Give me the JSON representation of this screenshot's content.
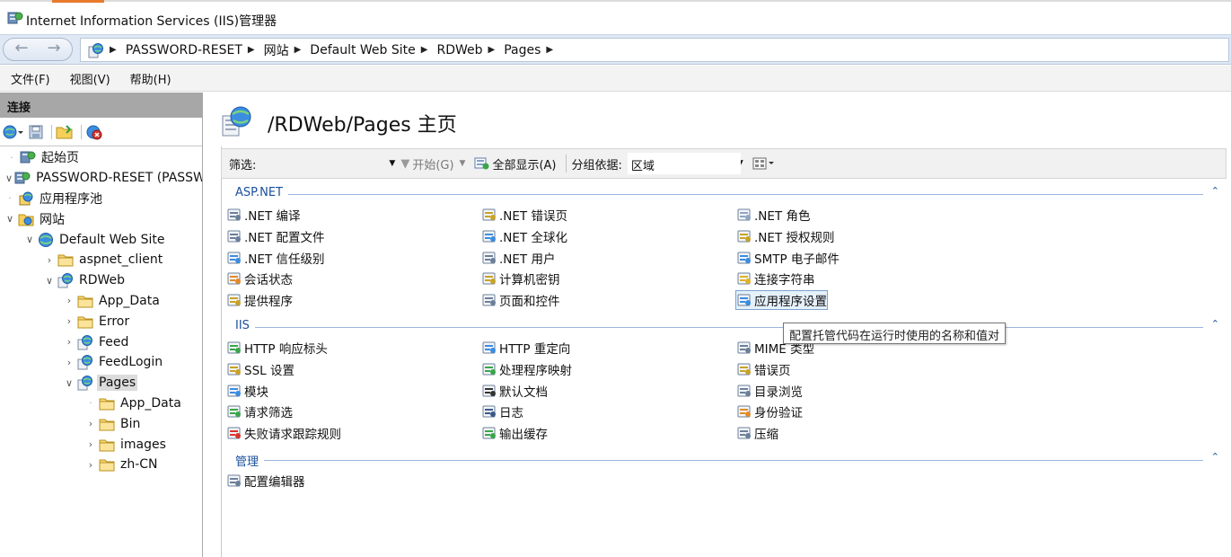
{
  "window": {
    "title": "Internet Information Services (IIS)管理器"
  },
  "address": {
    "crumbs": [
      "PASSWORD-RESET",
      "网站",
      "Default Web Site",
      "RDWeb",
      "Pages"
    ]
  },
  "menu": [
    "文件(F)",
    "视图(V)",
    "帮助(H)"
  ],
  "connections": {
    "header": "连接",
    "tree": [
      {
        "label": "起始页",
        "level": 0,
        "expander": "",
        "icon": "start-page-icon"
      },
      {
        "label": "PASSWORD-RESET (PASSW",
        "level": 0,
        "expander": "v",
        "icon": "server-icon"
      },
      {
        "label": "应用程序池",
        "level": 1,
        "expander": "",
        "icon": "app-pool-icon"
      },
      {
        "label": "网站",
        "level": 1,
        "expander": "v",
        "icon": "sites-folder-icon"
      },
      {
        "label": "Default Web Site",
        "level": 2,
        "expander": "v",
        "icon": "globe-icon"
      },
      {
        "label": "aspnet_client",
        "level": 3,
        "expander": ">",
        "icon": "folder-icon"
      },
      {
        "label": "RDWeb",
        "level": 3,
        "expander": "v",
        "icon": "web-app-icon"
      },
      {
        "label": "App_Data",
        "level": 4,
        "expander": ">",
        "icon": "folder-icon"
      },
      {
        "label": "Error",
        "level": 4,
        "expander": ">",
        "icon": "folder-icon"
      },
      {
        "label": "Feed",
        "level": 4,
        "expander": ">",
        "icon": "web-app-icon"
      },
      {
        "label": "FeedLogin",
        "level": 4,
        "expander": ">",
        "icon": "web-app-icon"
      },
      {
        "label": "Pages",
        "level": 4,
        "expander": "v",
        "icon": "web-app-icon",
        "selected": true
      },
      {
        "label": "App_Data",
        "level": 5,
        "expander": "",
        "icon": "folder-icon"
      },
      {
        "label": "Bin",
        "level": 5,
        "expander": ">",
        "icon": "folder-icon"
      },
      {
        "label": "images",
        "level": 5,
        "expander": ">",
        "icon": "folder-icon"
      },
      {
        "label": "zh-CN",
        "level": 5,
        "expander": ">",
        "icon": "folder-icon"
      }
    ]
  },
  "main": {
    "title": "/RDWeb/Pages 主页",
    "filter": {
      "label": "筛选:",
      "start": "开始(G)",
      "show_all": "全部显示(A)",
      "group_label": "分组依据:",
      "group_value": "区域"
    },
    "sections": [
      {
        "title": "ASP.NET",
        "items": [
          ".NET 编译",
          ".NET 错误页",
          ".NET 角色",
          ".NET 配置文件",
          ".NET 全球化",
          ".NET 授权规则",
          ".NET 信任级别",
          ".NET 用户",
          "SMTP 电子邮件",
          "会话状态",
          "计算机密钥",
          "连接字符串",
          "提供程序",
          "页面和控件",
          "应用程序设置"
        ]
      },
      {
        "title": "IIS",
        "items": [
          "HTTP 响应标头",
          "HTTP 重定向",
          "MIME 类型",
          "SSL 设置",
          "处理程序映射",
          "错误页",
          "模块",
          "默认文档",
          "目录浏览",
          "请求筛选",
          "日志",
          "身份验证",
          "失败请求跟踪规则",
          "输出缓存",
          "压缩"
        ]
      },
      {
        "title": "管理",
        "items": [
          "配置编辑器"
        ]
      }
    ],
    "tooltip": "配置托管代码在运行时使用的名称和值对"
  }
}
